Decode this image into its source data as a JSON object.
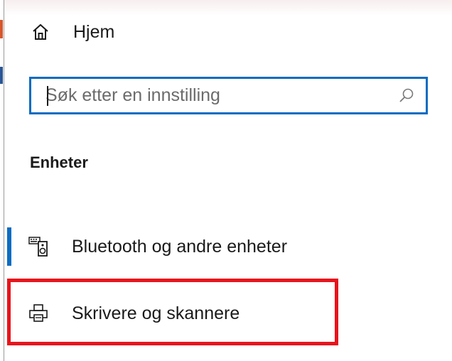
{
  "nav": {
    "home_label": "Hjem",
    "home_icon": "home-icon"
  },
  "search": {
    "placeholder": "Søk etter en innstilling",
    "value": "",
    "icon": "search-icon"
  },
  "section": {
    "heading": "Enheter"
  },
  "items": [
    {
      "label": "Bluetooth og andre enheter",
      "icon": "bluetooth-devices-icon",
      "selected": true
    },
    {
      "label": "Skrivere og skannere",
      "icon": "printer-icon",
      "selected": false,
      "highlighted": true
    }
  ],
  "colors": {
    "accent": "#0a6cc2",
    "highlight": "#e8141c"
  }
}
